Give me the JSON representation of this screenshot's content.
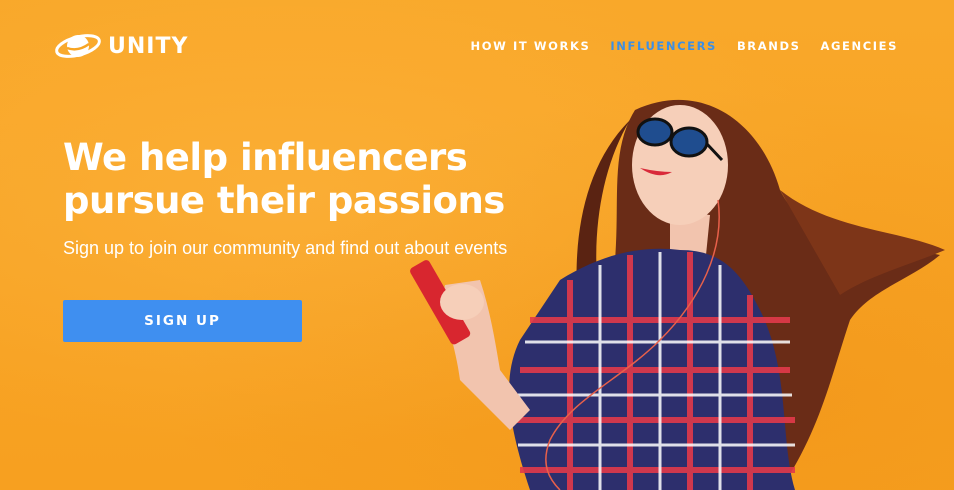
{
  "brand": {
    "name": "UNITY",
    "icon": "planet-logo-icon"
  },
  "nav": {
    "items": [
      {
        "label": "HOW IT WORKS",
        "active": false
      },
      {
        "label": "INFLUENCERS",
        "active": true
      },
      {
        "label": "BRANDS",
        "active": false
      },
      {
        "label": "AGENCIES",
        "active": false
      }
    ]
  },
  "hero": {
    "title_line1": "We help influencers",
    "title_line2": "pursue their passions",
    "subtitle": "Sign up to join our community and find out about events",
    "cta_label": "SIGN UP"
  },
  "colors": {
    "background": "#f8a523",
    "accent": "#3f8ff0",
    "active_nav": "#3d8fe4",
    "text": "#ffffff"
  }
}
